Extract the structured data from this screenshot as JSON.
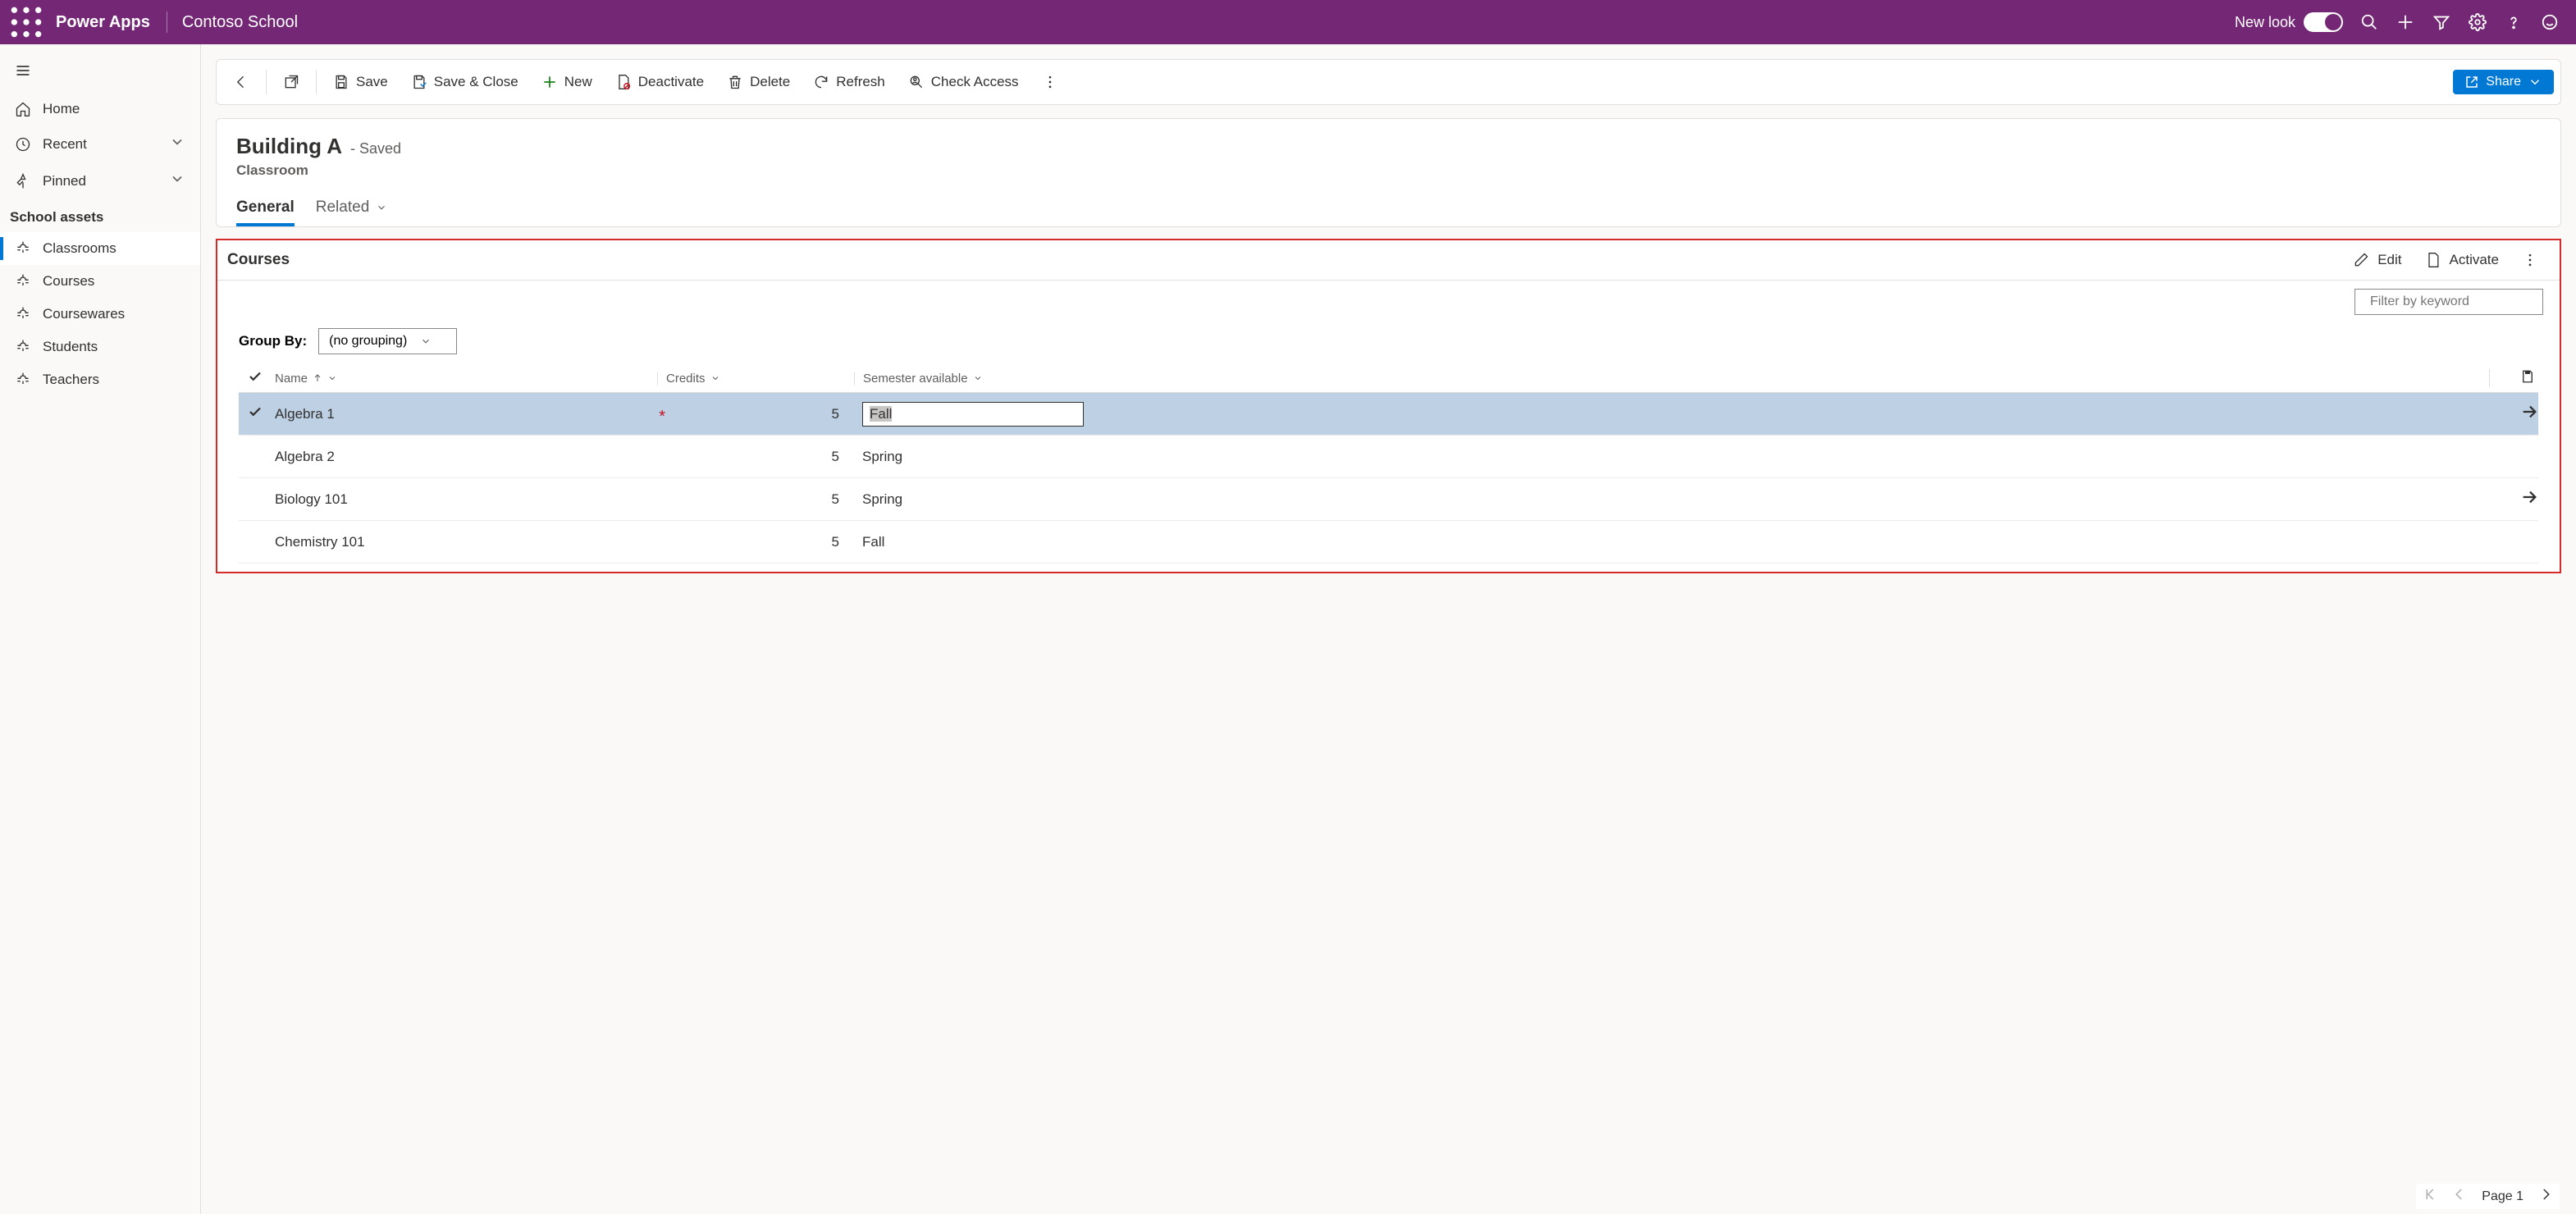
{
  "header": {
    "app_name": "Power Apps",
    "org_name": "Contoso School",
    "new_look_label": "New look"
  },
  "sidebar": {
    "home": "Home",
    "recent": "Recent",
    "pinned": "Pinned",
    "section": "School assets",
    "items": [
      "Classrooms",
      "Courses",
      "Coursewares",
      "Students",
      "Teachers"
    ]
  },
  "commands": {
    "save": "Save",
    "save_close": "Save & Close",
    "new": "New",
    "deactivate": "Deactivate",
    "delete": "Delete",
    "refresh": "Refresh",
    "check_access": "Check Access",
    "share": "Share"
  },
  "record": {
    "title": "Building A",
    "saved": "- Saved",
    "entity": "Classroom",
    "tabs": {
      "general": "General",
      "related": "Related"
    }
  },
  "subgrid": {
    "title": "Courses",
    "edit": "Edit",
    "activate": "Activate",
    "filter_placeholder": "Filter by keyword",
    "group_by_label": "Group By:",
    "group_by_value": "(no grouping)",
    "cols": {
      "name": "Name",
      "credits": "Credits",
      "semester": "Semester available"
    },
    "rows": [
      {
        "name": "Algebra 1",
        "credits": "5",
        "semester": "Fall",
        "selected": true,
        "editing": true,
        "dirty": true
      },
      {
        "name": "Algebra 2",
        "credits": "5",
        "semester": "Spring"
      },
      {
        "name": "Biology 101",
        "credits": "5",
        "semester": "Spring",
        "arrow": true
      },
      {
        "name": "Chemistry 101",
        "credits": "5",
        "semester": "Fall"
      }
    ]
  },
  "pager": {
    "page": "Page 1"
  }
}
